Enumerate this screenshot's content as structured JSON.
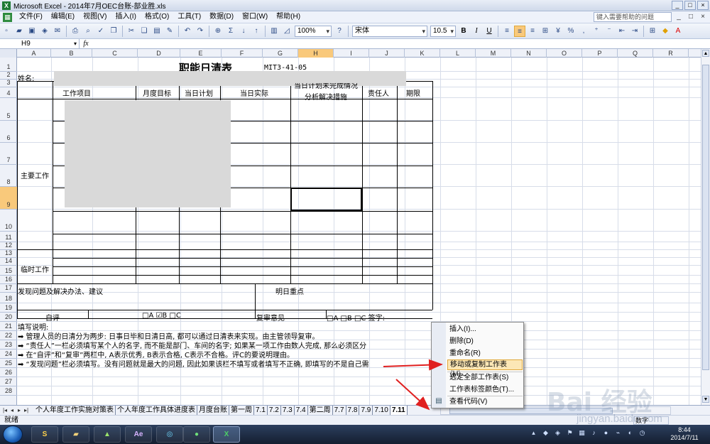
{
  "window": {
    "title": "Microsoft Excel - 2014年7月OEC台账-部业胜.xls",
    "app_icon": "X",
    "buttons": [
      "_",
      "□",
      "×"
    ]
  },
  "menu": {
    "items": [
      "文件(F)",
      "编辑(E)",
      "视图(V)",
      "插入(I)",
      "格式(O)",
      "工具(T)",
      "数据(D)",
      "窗口(W)",
      "帮助(H)"
    ],
    "help_placeholder": "键入需要帮助的问题",
    "doc_buttons": [
      "_",
      "□",
      "×"
    ]
  },
  "toolbar": {
    "zoom": "100%",
    "font": "宋体",
    "font_size": "10.5",
    "bold": "B",
    "italic": "I",
    "underline": "U",
    "percent": "%",
    "sum": "Σ"
  },
  "formula_bar": {
    "name_box": "H9",
    "fx": "fx",
    "value": ""
  },
  "columns": [
    "A",
    "B",
    "C",
    "D",
    "E",
    "F",
    "G",
    "H",
    "I",
    "J",
    "K",
    "L",
    "M",
    "N",
    "O",
    "P",
    "Q",
    "R",
    "S"
  ],
  "rows": [
    "1",
    "2",
    "3",
    "4",
    "5",
    "6",
    "7",
    "8",
    "9",
    "10",
    "11",
    "12",
    "13",
    "14",
    "15",
    "16",
    "17",
    "18",
    "19",
    "20",
    "21",
    "22",
    "23",
    "24",
    "25",
    "26",
    "27",
    "28"
  ],
  "sheet": {
    "title": "职能日清表",
    "code": "MIT3-41-05",
    "name_label": "姓名:",
    "headers": {
      "work_item": "工作项目",
      "monthly_goal": "月度目标",
      "daily_plan": "当日计划",
      "daily_actual": "当日实际",
      "analysis_1": "当日计划未完成情况",
      "analysis_2": "分析解决措施",
      "owner": "责任人",
      "deadline": "期限"
    },
    "main_work": "主要工作",
    "temp_work": "临时工作",
    "issues": "发现问题及解决办法、建议",
    "tomorrow": "明日重点",
    "self_eval": "自评",
    "self_opts": "□A  ☑B  □C",
    "review": "复审意见",
    "review_opts": "□A  □B  □C  签字:",
    "notes_title": "填写说明:",
    "notes": [
      "➡ 管理人员的日清分为两步: 日事日毕和日清日高, 都可以通过日清表来实现。由主管领导复审。",
      "➡ “责任人”一栏必须填写某个人的名字, 而不能是部门、车间的名字; 如果某一项工作由数人完成, 那么必须区分",
      "➡ 在“自评”和“复审”两栏中, A表示优秀, B表示合格, C表示不合格。评C的要说明理由。",
      "➡ “发现问题”栏必须填写。没有问题就是最大的问题, 因此如果该栏不填写或者填写不正确, 即填写的不是自己需"
    ]
  },
  "context_menu": {
    "items": [
      "插入(I)...",
      "删除(D)",
      "重命名(R)",
      "移动或复制工作表(M)...",
      "选定全部工作表(S)",
      "工作表标签颜色(T)...",
      "查看代码(V)"
    ],
    "highlighted": "移动或复制工作表(M)..."
  },
  "tabs": {
    "nav": [
      "|◂",
      "◂",
      "▸",
      "▸|"
    ],
    "items": [
      "个人年度工作实施对策表",
      "个人年度工作具体进度表",
      "月度台账",
      "第一周",
      "7.1",
      "7.2",
      "7.3",
      "7.4",
      "第二周",
      "7.7",
      "7.8",
      "7.9",
      "7.10",
      "7.11"
    ],
    "active": "7.11"
  },
  "status": {
    "ready": "就绪",
    "num": "数字"
  },
  "watermark": {
    "main": "Bai 经验",
    "sub": "jingyan.baidu.com"
  },
  "taskbar": {
    "apps": [
      "Ae"
    ],
    "clock_time": "8:44",
    "clock_date": "2014/7/11"
  },
  "colors": {
    "selection_header": "#f9c97b",
    "menu_highlight": "#fce7b6",
    "arrow": "#e02020"
  }
}
